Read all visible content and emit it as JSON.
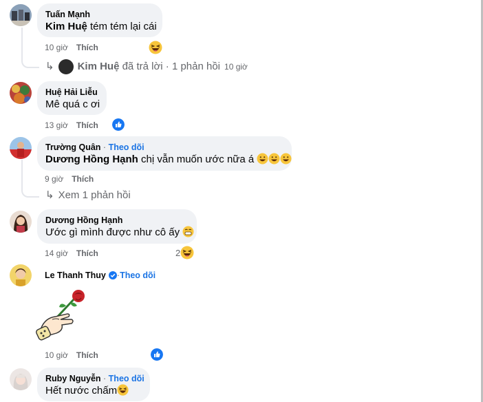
{
  "colors": {
    "bubble": "#f0f2f5",
    "link": "#1b74e4",
    "meta": "#65676b",
    "like": "#1877f2"
  },
  "comments": [
    {
      "author": "Tuấn Mạnh",
      "mention": "Kim Huệ",
      "text": " tém tém lại cái",
      "time": "10 giờ",
      "like": "Thích",
      "reaction": "laughing-emoji"
    },
    {
      "author": "Huệ Hải Liễu",
      "text": "Mê quá c ơi",
      "time": "13 giờ",
      "like": "Thích",
      "reaction": "like-icon"
    },
    {
      "author": "Trường Quân",
      "follow": "Theo dõi",
      "mention": "Dương Hồng Hạnh",
      "text": " chị vẫn muốn ước nữa á",
      "time": "9 giờ",
      "like": "Thích"
    },
    {
      "author": "Dương Hồng Hạnh",
      "text": "Ước gì mình được như cô ấy",
      "time": "14 giờ",
      "like": "Thích",
      "reaction_count": "2",
      "reaction": "laughing-emoji"
    },
    {
      "author": "Le Thanh Thuy",
      "follow": "Theo dõi",
      "time": "10 giờ",
      "like": "Thích",
      "sticker": "hand-holding-rose-sticker",
      "reaction": "like-icon"
    },
    {
      "author": "Ruby Nguyễn",
      "follow": "Theo dõi",
      "text": "Hết nước chấm",
      "reaction": "laughing-emoji"
    }
  ],
  "replies": [
    {
      "author": "Kim Huệ",
      "text": " đã trả lời · 1 phản hồi",
      "time": "10 giờ"
    },
    {
      "text": "Xem 1 phản hồi"
    }
  ],
  "separator": " · "
}
